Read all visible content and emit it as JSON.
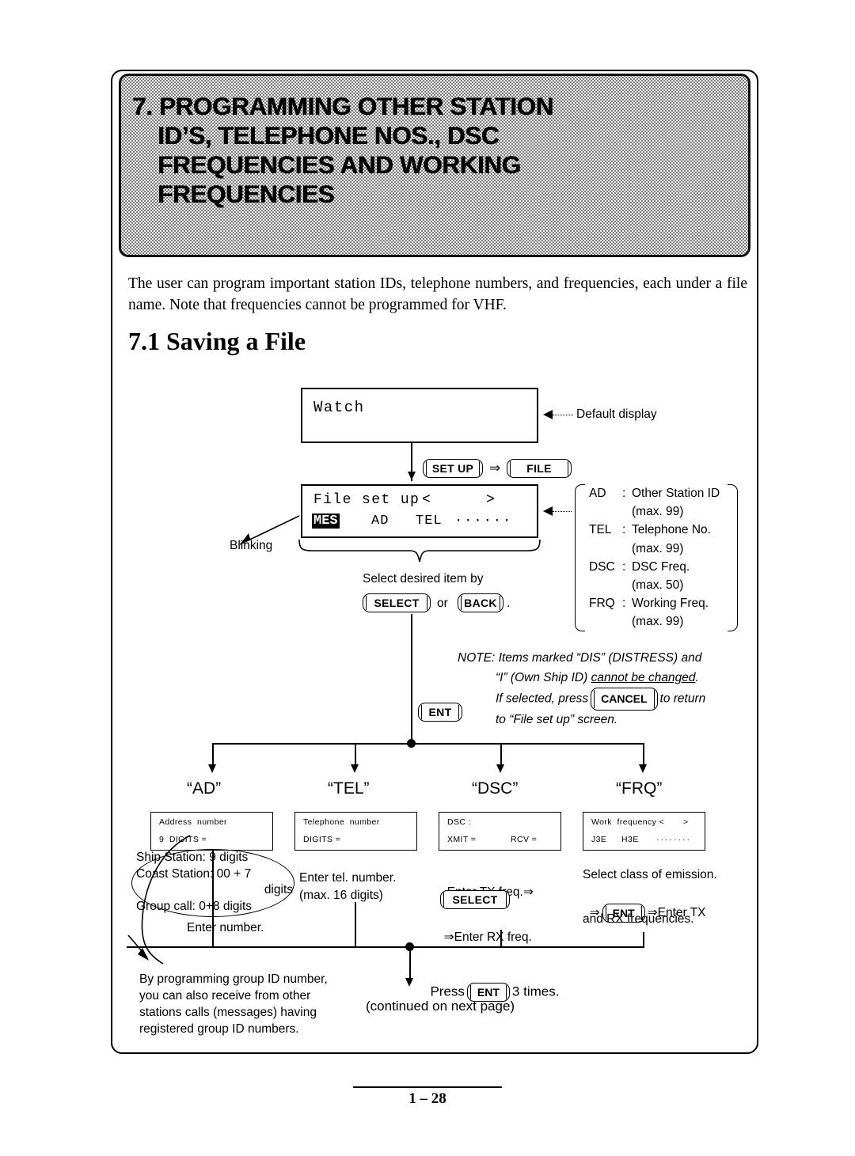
{
  "banner": {
    "lines": [
      "7. PROGRAMMING OTHER STATION",
      "ID’S, TELEPHONE NOS., DSC",
      "FREQUENCIES AND WORKING",
      "FREQUENCIES"
    ]
  },
  "intro": "The user can program important station IDs, telephone numbers, and frequencies, each under a file name. Note that frequencies cannot be programmed for VHF.",
  "section_title": "7.1 Saving a File",
  "watch_display": {
    "line1": "Watch",
    "callout": "Default display"
  },
  "keys": {
    "set_up": "SET UP",
    "file": "FILE",
    "select": "SELECT",
    "back": "BACK",
    "ent": "ENT",
    "cancel": "CANCEL"
  },
  "arrow_glyph": "⇒",
  "file_setup_display": {
    "line1_left": "File set up",
    "line1_lt": "<",
    "line1_gt": ">",
    "item_highlighted": "MES",
    "item2": "AD",
    "item3": "TEL",
    "dots": "······",
    "blinking_label": "Blinking"
  },
  "select_hint": {
    "line1": "Select desired item by",
    "or": "or",
    "period": "."
  },
  "legend": {
    "rows": [
      {
        "key": "AD",
        "colon": ":",
        "desc": "Other Station ID",
        "max": "(max. 99)"
      },
      {
        "key": "TEL",
        "colon": ":",
        "desc": "Telephone No.",
        "max": "(max. 99)"
      },
      {
        "key": "DSC",
        "colon": ":",
        "desc": "DSC Freq.",
        "max": "(max. 50)"
      },
      {
        "key": "FRQ",
        "colon": ":",
        "desc": "Working Freq.",
        "max": "(max. 99)"
      }
    ]
  },
  "note": {
    "label": "NOTE:",
    "line1": "Items marked “DIS” (DISTRESS) and",
    "line2_a": "“I” (Own Ship ID) ",
    "line2_underlined": "cannot be changed",
    "line2_b": ".",
    "line3_a": "If selected, press",
    "line3_b": "to return",
    "line4": "to “File set up” screen."
  },
  "branches": [
    {
      "label": "“AD”",
      "display": {
        "line1": "Address  number",
        "line2": "9  DIGITS ="
      },
      "ellipse": [
        "Ship Station: 9 digits",
        "Coast Station: 00 + 7",
        "digits",
        "Group call: 0+8 digits"
      ],
      "instruction": "Enter number."
    },
    {
      "label": "“TEL”",
      "display": {
        "line1": "Telephone  number",
        "line2": "DIGITS ="
      },
      "instruction_line1": "Enter tel. number.",
      "instruction_line2": "(max. 16 digits)"
    },
    {
      "label": "“DSC”",
      "display": {
        "line1": "DSC :",
        "line2a": "XMIT =",
        "line2b": "RCV ="
      },
      "instruction_line1": "Enter TX freq.",
      "instruction_line3": "Enter RX freq."
    },
    {
      "label": "“FRQ”",
      "display": {
        "line1a": "Work  frequency <",
        "line1b": ">",
        "line2a": "J3E",
        "line2b": "H3E",
        "line2c": "········"
      },
      "instruction_line1": "Select class of emission.",
      "instruction_line2_b": "Enter TX",
      "instruction_line3": "and RX frequencies."
    }
  ],
  "group_note": {
    "line1": "By programming group ID number,",
    "line2": "you can also receive from other",
    "line3": "stations calls (messages) having",
    "line4": "registered group ID numbers."
  },
  "press_ent": {
    "before": "Press",
    "after": "3 times."
  },
  "continued": "(continued on next page)",
  "footer": {
    "page_number": "1 – 28"
  }
}
